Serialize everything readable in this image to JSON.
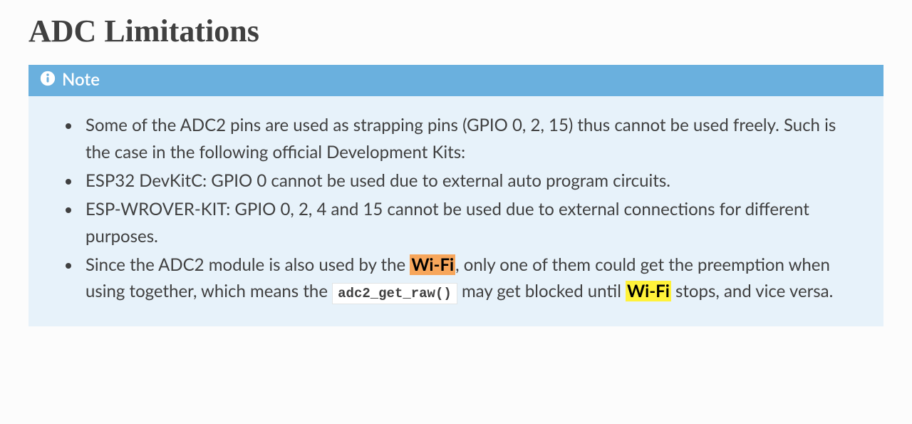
{
  "heading": "ADC Limitations",
  "note": {
    "label": "Note",
    "bullets": {
      "b1": "Some of the ADC2 pins are used as strapping pins (GPIO 0, 2, 15) thus cannot be used freely. Such is the case in the following official Development Kits:",
      "b2": "ESP32 DevKitC: GPIO 0 cannot be used due to external auto program circuits.",
      "b3": "ESP-WROVER-KIT: GPIO 0, 2, 4 and 15 cannot be used due to external connections for different purposes.",
      "b4_pre": "Since the ADC2 module is also used by the ",
      "b4_hl1": "Wi-Fi",
      "b4_mid1": ", only one of them could get the preemption when using together, which means the ",
      "b4_code": "adc2_get_raw()",
      "b4_mid2": " may get blocked until ",
      "b4_hl2": "Wi-Fi",
      "b4_post": " stops, and vice versa."
    }
  }
}
